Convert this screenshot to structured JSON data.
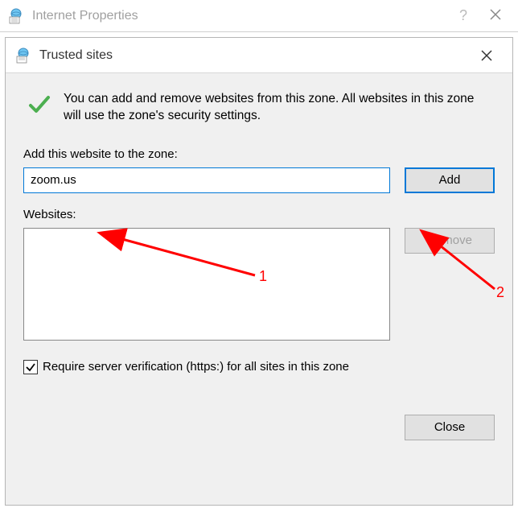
{
  "parent": {
    "title": "Internet Properties"
  },
  "dialog": {
    "title": "Trusted sites",
    "info_text": "You can add and remove websites from this zone. All websites in this zone will use the zone's security settings.",
    "add_label": "Add this website to the zone:",
    "add_value": "zoom.us",
    "add_button": "Add",
    "websites_label": "Websites:",
    "remove_button": "Remove",
    "checkbox_label": "Require server verification (https:) for all sites in this zone",
    "checkbox_checked": true,
    "close_button": "Close"
  },
  "annotations": {
    "arrow1_label": "1",
    "arrow2_label": "2"
  }
}
